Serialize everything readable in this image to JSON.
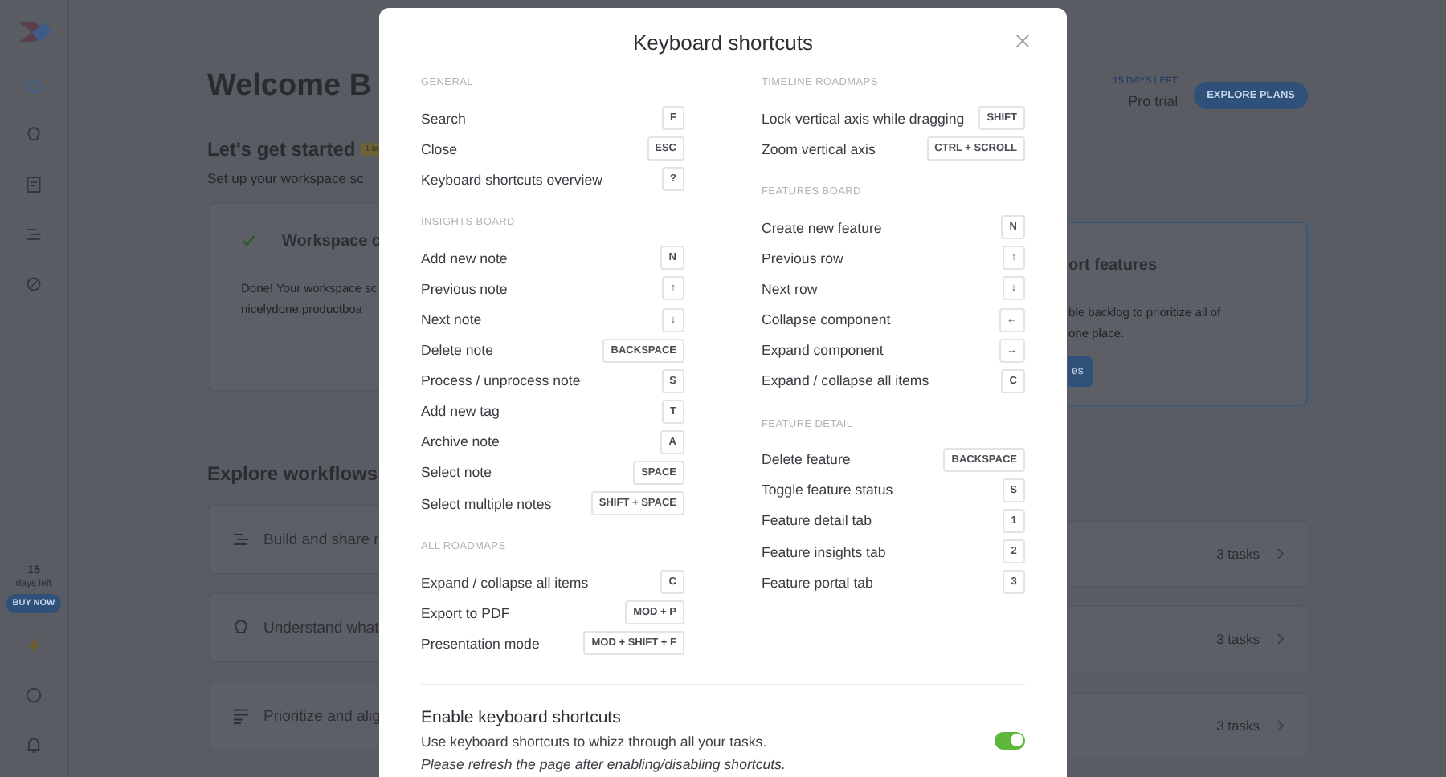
{
  "sidebar": {
    "trial_days": "15",
    "trial_caption": "days left",
    "buy_button": "BUY NOW"
  },
  "header": {
    "title": "Welcome B",
    "trial_badge": "15 DAYS LEFT",
    "plan": "Pro trial",
    "explore_button": "EXPLORE PLANS"
  },
  "getting_started": {
    "title": "Let's get started",
    "badge": "1 ta",
    "subtitle": "Set up your workspace sc",
    "cards": [
      {
        "title": "Workspace c",
        "text": [
          "Done! Your workspace sc",
          "nicelydone.productboa"
        ],
        "done": true
      },
      {
        "title": "ort features",
        "text": [
          "ble backlog to prioritize all of",
          "one place."
        ],
        "button": "es"
      }
    ]
  },
  "workflows": {
    "title": "Explore workflows",
    "rows": [
      {
        "kind": "roadmap",
        "title": "Build and share r",
        "tasks": "3 tasks"
      },
      {
        "kind": "insight",
        "title": "Understand what",
        "tasks": "3 tasks"
      },
      {
        "kind": "prioritize",
        "title": "Prioritize and alig",
        "tasks": "3 tasks"
      }
    ]
  },
  "modal": {
    "title": "Keyboard shortcuts",
    "columns": [
      [
        {
          "heading": "GENERAL",
          "shortcuts": [
            {
              "label": "Search",
              "key": "F"
            },
            {
              "label": "Close",
              "key": "ESC"
            },
            {
              "label": "Keyboard shortcuts overview",
              "key": "?"
            }
          ]
        },
        {
          "heading": "INSIGHTS BOARD",
          "shortcuts": [
            {
              "label": "Add new note",
              "key": "N"
            },
            {
              "label": "Previous note",
              "key": "↑"
            },
            {
              "label": "Next note",
              "key": "↓"
            },
            {
              "label": "Delete note",
              "key": "BACKSPACE"
            },
            {
              "label": "Process / unprocess note",
              "key": "S"
            },
            {
              "label": "Add new tag",
              "key": "T"
            },
            {
              "label": "Archive note",
              "key": "A"
            },
            {
              "label": "Select note",
              "key": "SPACE"
            },
            {
              "label": "Select multiple notes",
              "key": "SHIFT + SPACE"
            }
          ]
        },
        {
          "heading": "ALL ROADMAPS",
          "shortcuts": [
            {
              "label": "Expand / collapse all items",
              "key": "C"
            },
            {
              "label": "Export to PDF",
              "key": "MOD + P"
            },
            {
              "label": "Presentation mode",
              "key": "MOD + SHIFT + F"
            }
          ]
        }
      ],
      [
        {
          "heading": "TIMELINE ROADMAPS",
          "shortcuts": [
            {
              "label": "Lock vertical axis while dragging",
              "key": "SHIFT"
            },
            {
              "label": "Zoom vertical axis",
              "key": "CTRL + SCROLL"
            }
          ]
        },
        {
          "heading": "FEATURES BOARD",
          "shortcuts": [
            {
              "label": "Create new feature",
              "key": "N"
            },
            {
              "label": "Previous row",
              "key": "↑"
            },
            {
              "label": "Next row",
              "key": "↓"
            },
            {
              "label": "Collapse component",
              "key": "←"
            },
            {
              "label": "Expand component",
              "key": "→"
            },
            {
              "label": "Expand / collapse all items",
              "key": "C"
            }
          ]
        },
        {
          "heading": "FEATURE DETAIL",
          "shortcuts": [
            {
              "label": "Delete feature",
              "key": "BACKSPACE"
            },
            {
              "label": "Toggle feature status",
              "key": "S"
            },
            {
              "label": "Feature detail tab",
              "key": "1"
            },
            {
              "label": "Feature insights tab",
              "key": "2"
            },
            {
              "label": "Feature portal tab",
              "key": "3"
            }
          ]
        }
      ]
    ],
    "enable": {
      "title": "Enable keyboard shortcuts",
      "description": "Use keyboard shortcuts to whizz through all your tasks.",
      "note": "Please refresh the page after enabling/disabling shortcuts.",
      "on": true
    }
  }
}
